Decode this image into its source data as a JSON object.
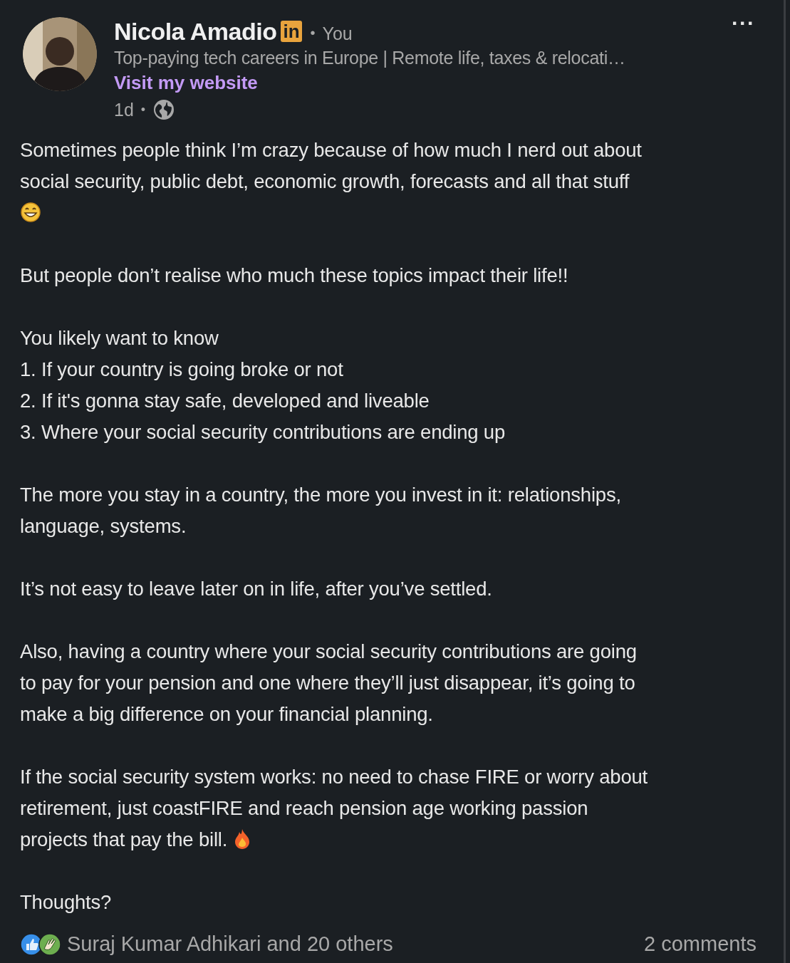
{
  "author": {
    "name": "Nicola Amadio",
    "badge": "in",
    "relation": "You",
    "separator": "•",
    "headline": "Top-paying tech careers in Europe | Remote life, taxes & relocati…",
    "link": "Visit my website",
    "time": "1d",
    "time_separator": "•"
  },
  "more_button": "···",
  "paragraphs": [
    {
      "lines": [
        "Sometimes people think I’m crazy because of how much I nerd out about",
        "social security, public debt, economic growth, forecasts and all that stuff",
        {
          "emoji": {
            "kind": "grin"
          }
        }
      ]
    },
    {
      "lines": [
        "But people don’t realise who much these topics impact their life!!"
      ]
    },
    {
      "lines": [
        "You likely want to know",
        "1. If your country is going broke or not",
        "2. If it's gonna stay safe, developed and liveable",
        "3. Where your social security contributions are ending up"
      ]
    },
    {
      "lines": [
        "The more you stay in a country, the more you invest in it: relationships,",
        "language, systems."
      ]
    },
    {
      "lines": [
        "It’s not easy to leave later on in life, after you’ve settled."
      ]
    },
    {
      "lines": [
        "Also, having a country where your social security contributions are going",
        "to pay for your pension and one where they’ll just disappear, it’s going to",
        "make a big difference on your financial planning."
      ]
    },
    {
      "lines": [
        "If the social security system works: no need to chase FIRE or worry about",
        "retirement, just coastFIRE and reach pension age working passion",
        {
          "text": "projects that pay the bill.",
          "emoji": {
            "kind": "fire"
          }
        }
      ]
    },
    {
      "lines": [
        "Thoughts?"
      ]
    }
  ],
  "reactions": {
    "icons": [
      {
        "kind": "like"
      },
      {
        "kind": "celebrate"
      }
    ],
    "summary": "Suraj Kumar Adhikari and 20 others",
    "comments": "2 comments"
  }
}
